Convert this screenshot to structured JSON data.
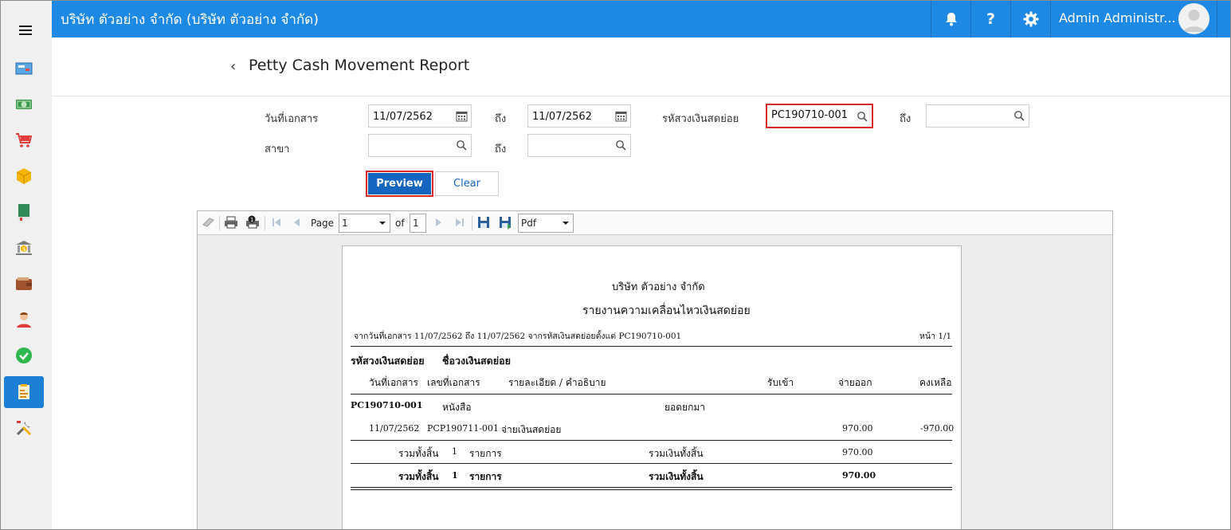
{
  "topbar": {
    "company": "บริษัท ตัวอย่าง จำกัด (บริษัท ตัวอย่าง จำกัด)",
    "user_name": "Admin Administr..."
  },
  "page": {
    "title": "Petty Cash Movement Report",
    "back_icon": "chevron-left-icon"
  },
  "form": {
    "doc_date_label": "วันที่เอกสาร",
    "date_from": "11/07/2562",
    "to_label": "ถึง",
    "date_to": "11/07/2562",
    "petty_code_label": "รหัสวงเงินสดย่อย",
    "petty_code_from": "PC190710-001",
    "petty_code_to": "",
    "branch_label": "สาขา",
    "branch_from": "",
    "branch_to": "",
    "preview_label": "Preview",
    "clear_label": "Clear"
  },
  "viewer": {
    "page_label": "Page",
    "page_value": "1",
    "of_label": "of",
    "total_pages": "1",
    "export_format": "Pdf"
  },
  "report": {
    "company": "บริษัท ตัวอย่าง จำกัด",
    "title": "รายงานความเคลื่อนไหวเงินสดย่อย",
    "filter_text": "จากวันที่เอกสาร 11/07/2562 ถึง 11/07/2562 จากรหัสเงินสดย่อยตั้งแต่ PC190710-001",
    "page_text": "หน้า 1/1",
    "col_code": "รหัสวงเงินสดย่อย",
    "col_name": "ชื่อวงเงินสดย่อย",
    "col_date": "วันที่เอกสาร",
    "col_docno": "เลขที่เอกสาร",
    "col_detail": "รายละเอียด / คำอธิบาย",
    "col_in": "รับเข้า",
    "col_out": "จ่ายออก",
    "col_balance": "คงเหลือ",
    "group_code": "PC190710-001",
    "group_name": "หนังสือ",
    "brought_forward": "ยอดยกมา",
    "row_date": "11/07/2562",
    "row_docno": "PCP190711-001",
    "row_detail": "จ่ายเงินสดย่อย",
    "row_out": "970.00",
    "row_balance": "-970.00",
    "sub_total_label": "รวมทั้งสิ้น",
    "sub_count": "1",
    "items_label": "รายการ",
    "sub_money_label": "รวมเงินทั้งสิ้น",
    "sub_out": "970.00",
    "grand_total_label": "รวมทั้งสิ้น",
    "grand_count": "1",
    "grand_items_label": "รายการ",
    "grand_money_label": "รวมเงินทั้งสิ้น",
    "grand_out": "970.00"
  }
}
